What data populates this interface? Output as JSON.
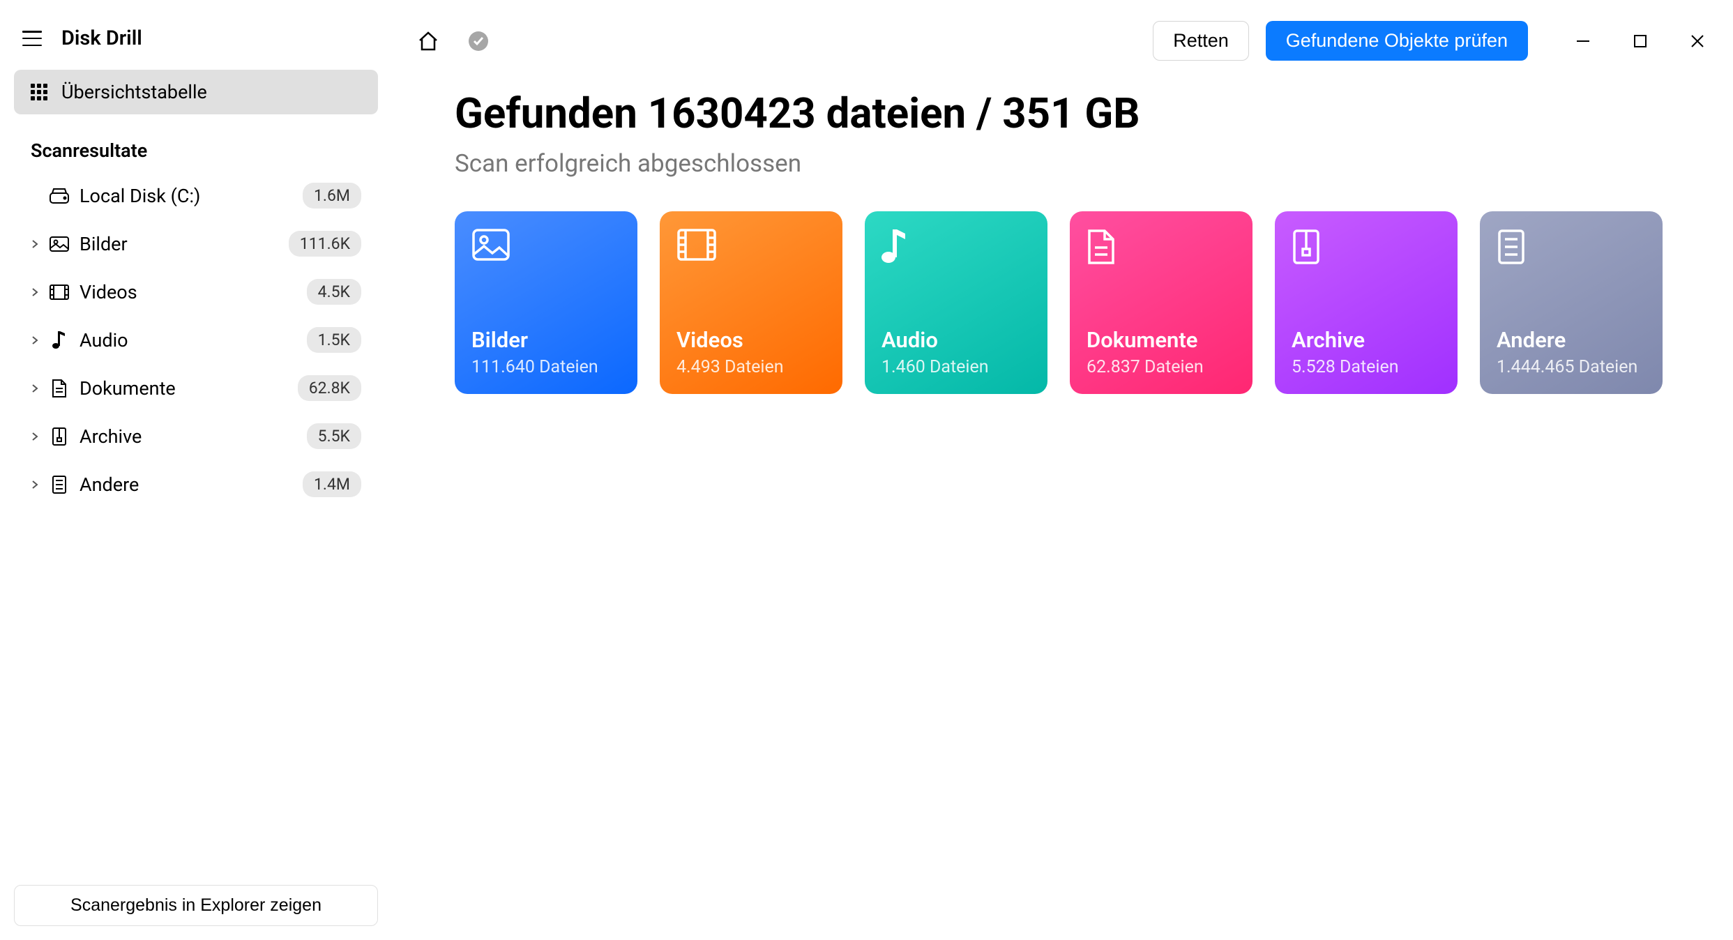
{
  "app": {
    "title": "Disk Drill"
  },
  "sidebar": {
    "overview_label": "Übersichtstabelle",
    "section_title": "Scanresultate",
    "items": [
      {
        "label": "Local Disk (C:)",
        "count": "1.6M",
        "icon": "disk",
        "expandable": false
      },
      {
        "label": "Bilder",
        "count": "111.6K",
        "icon": "image",
        "expandable": true
      },
      {
        "label": "Videos",
        "count": "4.5K",
        "icon": "video",
        "expandable": true
      },
      {
        "label": "Audio",
        "count": "1.5K",
        "icon": "audio",
        "expandable": true
      },
      {
        "label": "Dokumente",
        "count": "62.8K",
        "icon": "document",
        "expandable": true
      },
      {
        "label": "Archive",
        "count": "5.5K",
        "icon": "archive",
        "expandable": true
      },
      {
        "label": "Andere",
        "count": "1.4M",
        "icon": "other",
        "expandable": true
      }
    ],
    "footer_button": "Scanergebnis in Explorer zeigen"
  },
  "topbar": {
    "save_button": "Retten",
    "review_button": "Gefundene Objekte prüfen"
  },
  "summary": {
    "headline": "Gefunden 1630423 dateien / 351 GB",
    "subline": "Scan erfolgreich abgeschlossen"
  },
  "tiles": [
    {
      "key": "bilder",
      "title": "Bilder",
      "count": "111.640 Dateien"
    },
    {
      "key": "videos",
      "title": "Videos",
      "count": "4.493 Dateien"
    },
    {
      "key": "audio",
      "title": "Audio",
      "count": "1.460 Dateien"
    },
    {
      "key": "dokumente",
      "title": "Dokumente",
      "count": "62.837 Dateien"
    },
    {
      "key": "archive",
      "title": "Archive",
      "count": "5.528 Dateien"
    },
    {
      "key": "andere",
      "title": "Andere",
      "count": "1.444.465 Dateien"
    }
  ]
}
